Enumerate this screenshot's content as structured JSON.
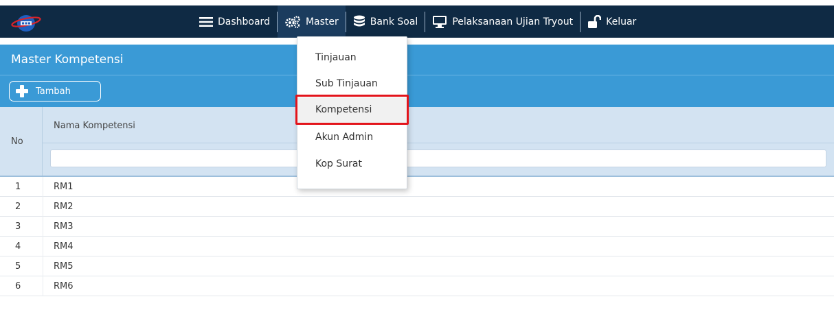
{
  "nav": {
    "logo_icon": "app-logo",
    "items": [
      {
        "label": "Dashboard",
        "icon": "menu-icon"
      },
      {
        "label": "Master",
        "icon": "gears-icon"
      },
      {
        "label": "Bank Soal",
        "icon": "database-icon"
      },
      {
        "label": "Pelaksanaan Ujian Tryout",
        "icon": "monitor-icon"
      },
      {
        "label": "Keluar",
        "icon": "unlock-icon"
      }
    ],
    "active": "Master"
  },
  "page": {
    "title": "Master Kompetensi",
    "add_label": "Tambah"
  },
  "table": {
    "headers": {
      "no": "No",
      "name": "Nama Kompetensi"
    },
    "filter_value": "",
    "rows": [
      {
        "no": "1",
        "name": "RM1"
      },
      {
        "no": "2",
        "name": "RM2"
      },
      {
        "no": "3",
        "name": "RM3"
      },
      {
        "no": "4",
        "name": "RM4"
      },
      {
        "no": "5",
        "name": "RM5"
      },
      {
        "no": "6",
        "name": "RM6"
      }
    ]
  },
  "master_menu": {
    "items": [
      "Tinjauan",
      "Sub Tinjauan",
      "Kompetensi",
      "Akun Admin",
      "Kop Surat"
    ],
    "highlighted": "Kompetensi"
  },
  "colors": {
    "nav_bg": "#0f2a44",
    "title_bg": "#3a9ad6",
    "header_bg": "#d3e3f2",
    "highlight_box": "#e3141b"
  }
}
